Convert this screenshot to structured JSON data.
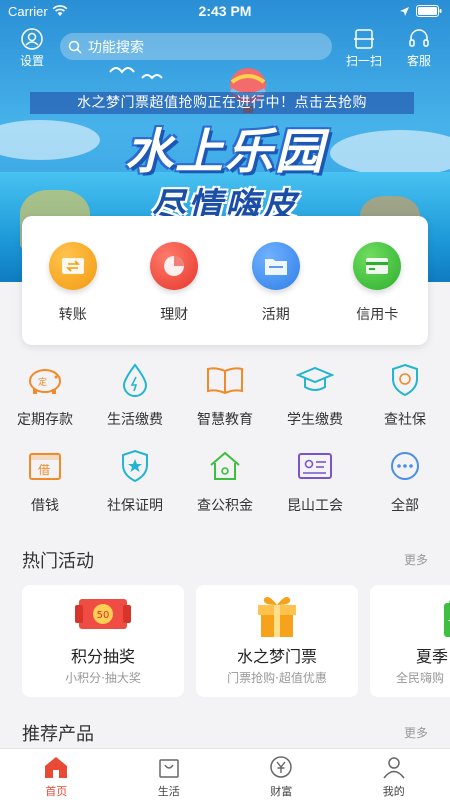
{
  "status_bar": {
    "carrier": "Carrier",
    "time": "2:43 PM"
  },
  "header": {
    "settings_label": "设置",
    "search_placeholder": "功能搜索",
    "scan_label": "扫一扫",
    "service_label": "客服"
  },
  "banner": {
    "promo_text": "水之梦门票超值抢购正在进行中！点击去抢购",
    "headline": "水上乐园",
    "subheadline": "尽情嗨皮"
  },
  "quick_actions": [
    {
      "label": "转账",
      "icon": "transfer-icon",
      "color": "#f6a21b"
    },
    {
      "label": "理财",
      "icon": "pie-chart-icon",
      "color": "#ef4d43"
    },
    {
      "label": "活期",
      "icon": "folder-icon",
      "color": "#3b8ef0"
    },
    {
      "label": "信用卡",
      "icon": "credit-card-icon",
      "color": "#3fbf3f"
    }
  ],
  "services": [
    {
      "label": "定期存款",
      "icon": "piggy-bank-icon"
    },
    {
      "label": "生活缴费",
      "icon": "water-drop-icon"
    },
    {
      "label": "智慧教育",
      "icon": "open-book-icon"
    },
    {
      "label": "学生缴费",
      "icon": "graduation-cap-icon"
    },
    {
      "label": "查社保",
      "icon": "shield-icon"
    },
    {
      "label": "借钱",
      "icon": "borrow-icon"
    },
    {
      "label": "社保证明",
      "icon": "star-shield-icon"
    },
    {
      "label": "查公积金",
      "icon": "house-icon"
    },
    {
      "label": "昆山工会",
      "icon": "id-card-icon"
    },
    {
      "label": "全部",
      "icon": "more-dots-icon"
    }
  ],
  "hot_activities": {
    "title": "热门活动",
    "more": "更多",
    "items": [
      {
        "title": "积分抽奖",
        "subtitle": "小积分·抽大奖",
        "badge": "50"
      },
      {
        "title": "水之梦门票",
        "subtitle": "门票抢购·超值优惠"
      },
      {
        "title": "夏季",
        "subtitle": "全民嗨购"
      }
    ]
  },
  "recommended": {
    "title": "推荐产品",
    "more": "更多"
  },
  "tabbar": [
    {
      "label": "首页",
      "active": true
    },
    {
      "label": "生活",
      "active": false
    },
    {
      "label": "财富",
      "active": false
    },
    {
      "label": "我的",
      "active": false
    }
  ],
  "colors": {
    "accent": "#e84a35",
    "service_orange": "#f08a2a",
    "service_teal": "#23b5cf",
    "service_green": "#3fbf3f",
    "service_purple": "#7a55c9",
    "service_blue": "#4a8ee8"
  }
}
